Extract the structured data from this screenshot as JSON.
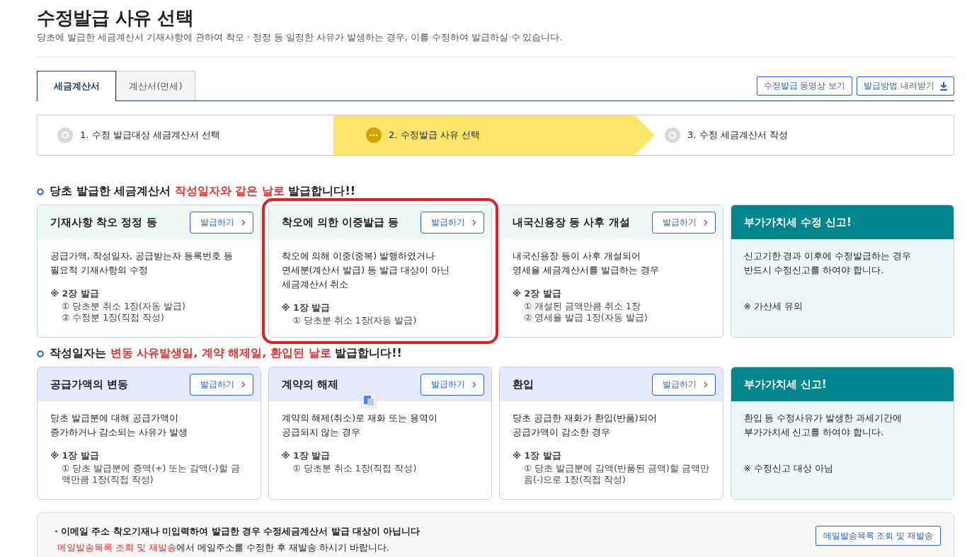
{
  "page": {
    "title": "수정발급 사유 선택",
    "subtitle": "당초에 발급한 세금계산서 기재사항에 관하여 착오 · 정정 등 일정한 사유가 발생하는 경우, 이를 수정하여 발급하실 수 있습니다."
  },
  "tabs": [
    {
      "label": "세금계산서",
      "selected": true
    },
    {
      "label": "계산서(면세)",
      "selected": false
    }
  ],
  "toolbar_buttons": [
    {
      "label": "수정발급 동영상 보기",
      "kind": "plain"
    },
    {
      "label": "발급방법 내려받기",
      "kind": "download"
    }
  ],
  "steps": [
    {
      "label": "1. 수정 발급대상 세금계산서 선택",
      "current": false
    },
    {
      "label": "2. 수정발급 사유 선택",
      "current": true
    },
    {
      "label": "3. 수정 세금계산서 작성",
      "current": false
    }
  ],
  "sections": [
    {
      "kind": "mint",
      "heading": [
        {
          "text": "당초 발급한 세금계산서 ",
          "emphasis": false
        },
        {
          "text": "작성일자와 같은 날로",
          "emphasis": true
        },
        {
          "text": " 발급합니다!!",
          "emphasis": false
        }
      ],
      "cards": [
        {
          "kind": "action",
          "title": "기재사항 착오 정정 등",
          "button": "발급하기",
          "highlighted": false,
          "translate_badge": false,
          "description": [
            "공급가액, 작성일자, 공급받는자 등록번호 등",
            "필요적 기재사항의 수정"
          ],
          "note_mark": "※",
          "note_title": "2장 발급",
          "note_items": [
            "① 당초분 취소 1장(자동 발급)",
            "② 수정분 1장(직접 작성)"
          ]
        },
        {
          "kind": "action",
          "title": "착오에 의한 이중발급 등",
          "button": "발급하기",
          "highlighted": true,
          "translate_badge": false,
          "description": [
            "착오에 의해 이중(중복) 발행하였거나",
            "면세분(계산서 발급) 등 발급 대상이 아닌",
            "세금계산서 취소"
          ],
          "note_mark": "※",
          "note_title": "1장 발급",
          "note_items": [
            "① 당초분 취소 1장(자동 발급)"
          ]
        },
        {
          "kind": "action",
          "title": "내국신용장 등 사후 개설",
          "button": "발급하기",
          "highlighted": false,
          "translate_badge": false,
          "description": [
            "내국신용장 등이 사후 개설되어",
            "영세율 세금계산서를 발급하는 경우"
          ],
          "note_mark": "※",
          "note_title": "2장 발급",
          "note_items": [
            "① 개설된 금액만큼 취소 1장",
            "② 영세율 발급 1장(자동 발급)"
          ]
        },
        {
          "kind": "notice",
          "title": "부가가치세 수정 신고!",
          "highlighted": false,
          "translate_badge": false,
          "description": [
            "신고기한 경과 이후에 수정발급하는 경우",
            "반드시 수정신고를 하여야 합니다."
          ],
          "note": "※ 가산세 유의"
        }
      ]
    },
    {
      "kind": "lavender",
      "heading": [
        {
          "text": "작성일자는 ",
          "emphasis": false
        },
        {
          "text": "변동 사유발생일, 계약 해제일, 환입된 날로",
          "emphasis": true
        },
        {
          "text": " 발급합니다!!",
          "emphasis": false
        }
      ],
      "cards": [
        {
          "kind": "action",
          "title": "공급가액의 변동",
          "button": "발급하기",
          "highlighted": false,
          "translate_badge": false,
          "description": [
            "당초 발급분에 대해 공급가액이",
            "증가하거나 감소되는 사유가 발생"
          ],
          "note_mark": "※",
          "note_title": "1장 발급",
          "note_items": [
            "① 당초 발급분에 증액(+) 또는 감액(-)할 금액만큼 1장(직접 작성)"
          ]
        },
        {
          "kind": "action",
          "title": "계약의 해제",
          "button": "발급하기",
          "highlighted": false,
          "translate_badge": true,
          "description": [
            "계약의 해제(취소)로 재화 또는 용역이",
            "공급되지 않는 경우"
          ],
          "note_mark": "※",
          "note_title": "1장 발급",
          "note_items": [
            "① 당초분 취소 1장(직접 작성)"
          ]
        },
        {
          "kind": "action",
          "title": "환입",
          "button": "발급하기",
          "highlighted": false,
          "translate_badge": false,
          "description": [
            "당초 공급한 재화가 환입(반품)되어",
            "공급가액이 감소한 경우"
          ],
          "note_mark": "※",
          "note_title": "1장 발급",
          "note_items": [
            "① 당초 발급분에 감액(반품된 금액)할 금액만 음(-)으로 1장(직접 작성)"
          ]
        },
        {
          "kind": "notice",
          "title": "부가가치세 신고!",
          "highlighted": false,
          "translate_badge": false,
          "description": [
            "환입 등 수정사유가 발생한 과세기간에",
            "부가가치세 신고를 하여야 합니다."
          ],
          "note": "※ 수정신고 대상 아님"
        }
      ]
    }
  ],
  "email_notice": {
    "bullet": "·",
    "headline": "이메일 주소 착오기재나 미입력하여 발급한 경우 수정세금계산서 발급 대상이 아닙니다",
    "link": "메일발송목록 조회 및 재발송",
    "rest": "에서 메일주소를 수정한 후 재발송 하시기 바랍니다.",
    "button": "메일발송목록 조회 및 재발송"
  }
}
